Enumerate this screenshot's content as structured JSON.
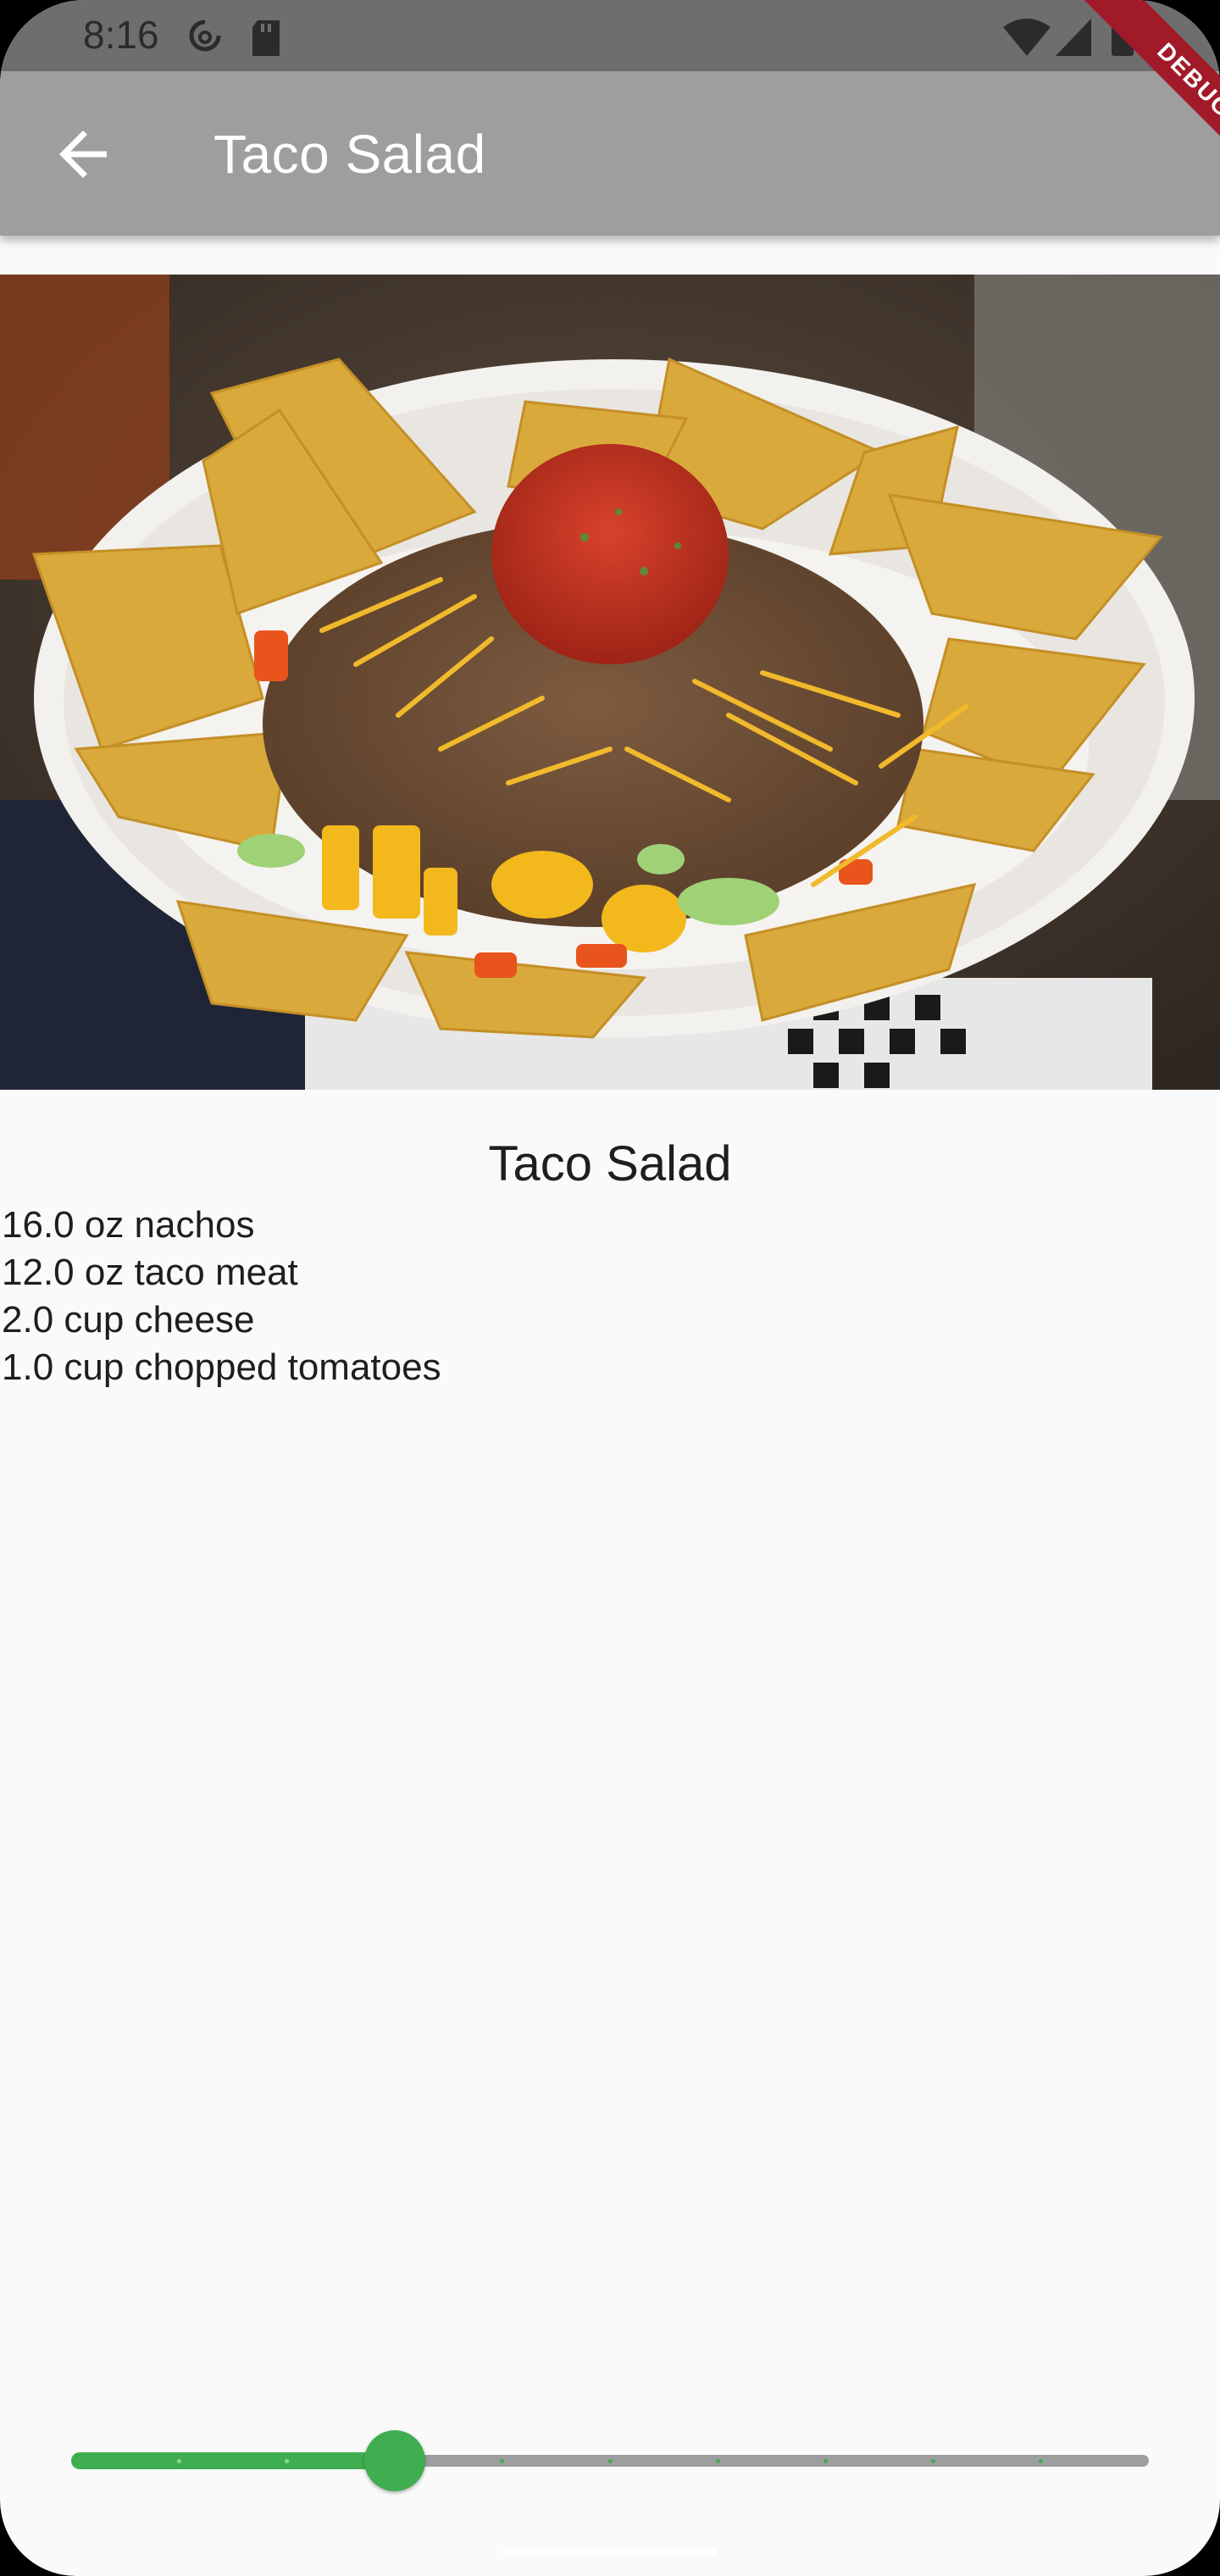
{
  "status_bar": {
    "time": "8:16",
    "icons": [
      "data-saver-icon",
      "sd-card-icon",
      "wifi-icon",
      "signal-icon",
      "battery-icon"
    ]
  },
  "app_bar": {
    "title": "Taco Salad",
    "back_icon": "arrow-back-icon",
    "debug_banner": "DEBUG"
  },
  "recipe": {
    "title": "Taco Salad",
    "image_description": "bowl-of-taco-salad",
    "ingredients": [
      "16.0 oz nachos",
      "12.0 oz taco meat",
      "2.0 cup cheese",
      "1.0 cup chopped tomatoes"
    ]
  },
  "serving_slider": {
    "min": 0,
    "max": 10,
    "divisions": 10,
    "value": 3
  },
  "colors": {
    "app_bar": "#9e9e9e",
    "status_bar": "#6e6e6e",
    "accent": "#3fae50",
    "background": "#fafafa",
    "debug": "#a11a2a"
  }
}
